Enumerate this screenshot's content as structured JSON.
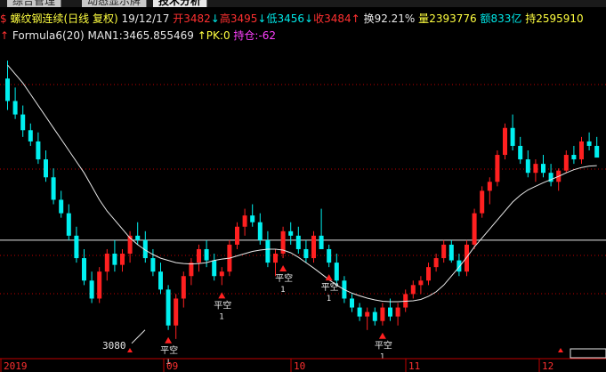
{
  "tabs": [
    {
      "label": "综合管理",
      "active": false
    },
    {
      "label": "动态显示牌",
      "active": false
    },
    {
      "label": "技术分析",
      "active": true
    }
  ],
  "header": {
    "title_icon": "$",
    "name": "螺纹钢连续",
    "period": "(日线 复权)",
    "date": "19/12/17",
    "open_label": "开",
    "open": "3482",
    "high_label": "高",
    "high": "3495",
    "low_label": "低",
    "low": "3456",
    "close_label": "收",
    "close": "3484",
    "turnover_label": "换",
    "turnover": "92.21%",
    "volume_label": "量",
    "volume": "2393776",
    "amount_label": "额",
    "amount": "833亿",
    "oi_label": "持",
    "oi": "2595910"
  },
  "indicator": {
    "name": "Formula6(20)",
    "man1_label": "MAN1:",
    "man1": "3465.855469",
    "pk_label": "PK:",
    "pk": "0",
    "position_label": "持仓:",
    "position": "-62"
  },
  "chart": {
    "price_low_label": "3080",
    "signal_text": "平空",
    "signal_count": "1",
    "x_labels": [
      "2019",
      "09",
      "10",
      "11",
      "12"
    ],
    "colors": {
      "up": "#ff2020",
      "down": "#00f0f0",
      "ma": "#e8e8e8",
      "grid": "#c00000",
      "hline": "#e8e8e8"
    }
  },
  "chart_data": {
    "type": "candlestick",
    "series": [
      {
        "values": [
          [
            3660,
            3700,
            3590,
            3610
          ],
          [
            3610,
            3640,
            3570,
            3580
          ],
          [
            3580,
            3600,
            3530,
            3545
          ],
          [
            3545,
            3560,
            3510,
            3520
          ],
          [
            3520,
            3540,
            3470,
            3480
          ],
          [
            3480,
            3500,
            3430,
            3440
          ],
          [
            3440,
            3460,
            3380,
            3390
          ],
          [
            3390,
            3410,
            3350,
            3360
          ],
          [
            3360,
            3380,
            3300,
            3310
          ],
          [
            3310,
            3330,
            3250,
            3260
          ],
          [
            3260,
            3280,
            3200,
            3210
          ],
          [
            3210,
            3230,
            3160,
            3170
          ],
          [
            3170,
            3240,
            3160,
            3230
          ],
          [
            3230,
            3280,
            3210,
            3270
          ],
          [
            3270,
            3300,
            3230,
            3245
          ],
          [
            3245,
            3280,
            3230,
            3270
          ],
          [
            3270,
            3320,
            3250,
            3310
          ],
          [
            3310,
            3340,
            3290,
            3300
          ],
          [
            3300,
            3320,
            3250,
            3260
          ],
          [
            3260,
            3280,
            3220,
            3230
          ],
          [
            3230,
            3250,
            3180,
            3190
          ],
          [
            3190,
            3200,
            3100,
            3110
          ],
          [
            3110,
            3180,
            3080,
            3170
          ],
          [
            3170,
            3230,
            3150,
            3220
          ],
          [
            3220,
            3260,
            3200,
            3250
          ],
          [
            3250,
            3290,
            3230,
            3280
          ],
          [
            3280,
            3300,
            3240,
            3255
          ],
          [
            3255,
            3270,
            3210,
            3220
          ],
          [
            3220,
            3240,
            3200,
            3230
          ],
          [
            3230,
            3300,
            3220,
            3290
          ],
          [
            3290,
            3340,
            3280,
            3330
          ],
          [
            3330,
            3370,
            3310,
            3355
          ],
          [
            3355,
            3380,
            3330,
            3340
          ],
          [
            3340,
            3360,
            3290,
            3300
          ],
          [
            3300,
            3320,
            3240,
            3250
          ],
          [
            3250,
            3280,
            3220,
            3270
          ],
          [
            3270,
            3330,
            3260,
            3320
          ],
          [
            3320,
            3340,
            3290,
            3310
          ],
          [
            3310,
            3330,
            3270,
            3280
          ],
          [
            3280,
            3300,
            3250,
            3260
          ],
          [
            3260,
            3320,
            3250,
            3310
          ],
          [
            3310,
            3370,
            3290,
            3280
          ],
          [
            3280,
            3290,
            3240,
            3250
          ],
          [
            3250,
            3270,
            3200,
            3210
          ],
          [
            3210,
            3220,
            3160,
            3170
          ],
          [
            3170,
            3180,
            3140,
            3150
          ],
          [
            3150,
            3160,
            3120,
            3130
          ],
          [
            3130,
            3150,
            3100,
            3140
          ],
          [
            3140,
            3150,
            3110,
            3120
          ],
          [
            3120,
            3160,
            3110,
            3150
          ],
          [
            3150,
            3170,
            3120,
            3130
          ],
          [
            3130,
            3160,
            3110,
            3150
          ],
          [
            3150,
            3190,
            3140,
            3180
          ],
          [
            3180,
            3210,
            3170,
            3200
          ],
          [
            3200,
            3220,
            3180,
            3210
          ],
          [
            3210,
            3250,
            3200,
            3240
          ],
          [
            3240,
            3270,
            3230,
            3260
          ],
          [
            3260,
            3300,
            3250,
            3290
          ],
          [
            3290,
            3300,
            3250,
            3255
          ],
          [
            3255,
            3270,
            3220,
            3230
          ],
          [
            3230,
            3300,
            3220,
            3290
          ],
          [
            3290,
            3370,
            3280,
            3360
          ],
          [
            3360,
            3420,
            3350,
            3410
          ],
          [
            3410,
            3440,
            3380,
            3430
          ],
          [
            3430,
            3500,
            3420,
            3490
          ],
          [
            3490,
            3560,
            3480,
            3550
          ],
          [
            3550,
            3580,
            3500,
            3510
          ],
          [
            3510,
            3530,
            3470,
            3480
          ],
          [
            3480,
            3500,
            3440,
            3450
          ],
          [
            3450,
            3480,
            3430,
            3470
          ],
          [
            3470,
            3490,
            3440,
            3450
          ],
          [
            3450,
            3470,
            3420,
            3430
          ],
          [
            3430,
            3460,
            3410,
            3455
          ],
          [
            3455,
            3500,
            3450,
            3490
          ],
          [
            3490,
            3510,
            3470,
            3480
          ],
          [
            3480,
            3530,
            3470,
            3520
          ],
          [
            3520,
            3540,
            3500,
            3510
          ],
          [
            3510,
            3530,
            3490,
            3484
          ]
        ]
      },
      {
        "name": "MAN1",
        "values": [
          3690,
          3670,
          3650,
          3625,
          3600,
          3575,
          3550,
          3525,
          3500,
          3475,
          3450,
          3420,
          3390,
          3365,
          3345,
          3325,
          3305,
          3290,
          3278,
          3268,
          3260,
          3255,
          3250,
          3248,
          3247,
          3248,
          3250,
          3255,
          3258,
          3260,
          3265,
          3270,
          3275,
          3278,
          3280,
          3280,
          3278,
          3272,
          3262,
          3250,
          3238,
          3225,
          3212,
          3200,
          3190,
          3182,
          3176,
          3171,
          3167,
          3164,
          3163,
          3163,
          3164,
          3165,
          3168,
          3175,
          3185,
          3200,
          3220,
          3240,
          3262,
          3285,
          3305,
          3325,
          3345,
          3365,
          3385,
          3400,
          3412,
          3420,
          3428,
          3435,
          3442,
          3450,
          3457,
          3462,
          3465,
          3466
        ]
      }
    ],
    "hline": 3300,
    "ylim": [
      3050,
      3720
    ],
    "signals": [
      21,
      28,
      36,
      42,
      49
    ],
    "annotations": [
      "3080"
    ],
    "x_labels": [
      "2019",
      "09",
      "10",
      "11",
      "12"
    ]
  }
}
